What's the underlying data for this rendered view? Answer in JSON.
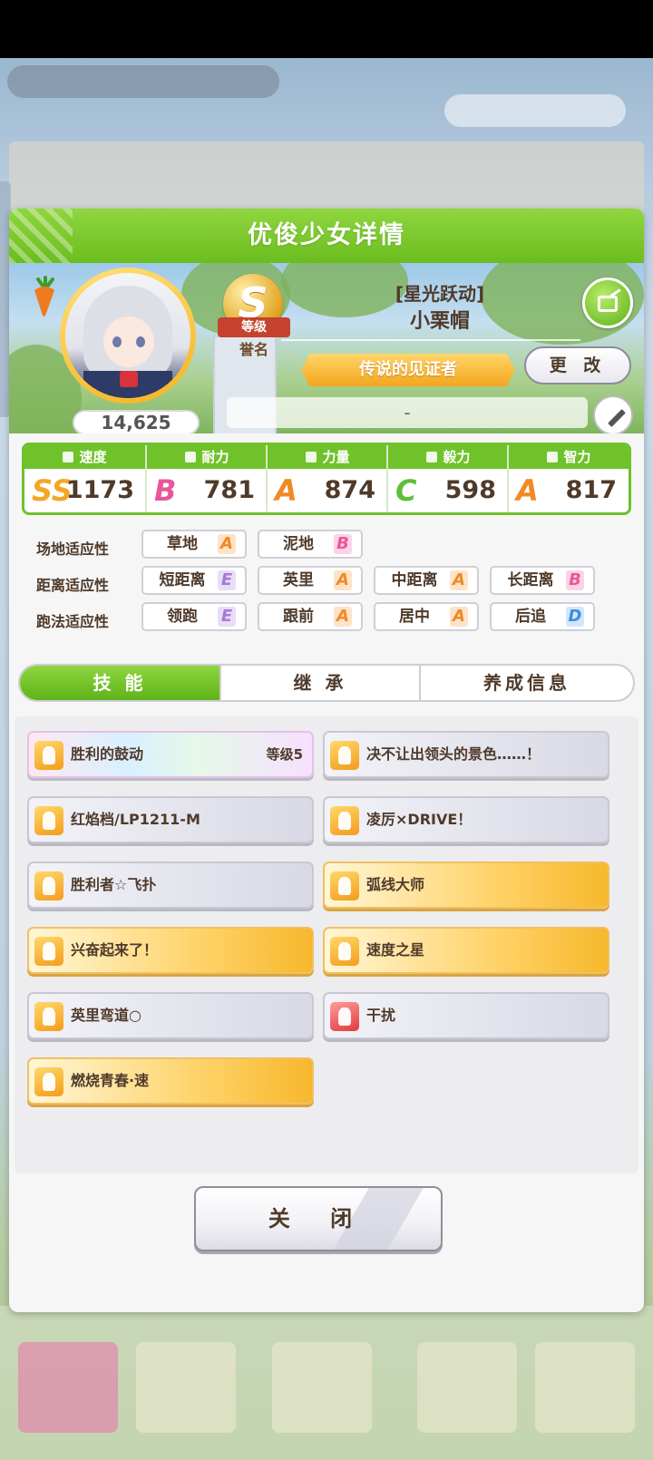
{
  "dialog": {
    "title": "优俊少女详情"
  },
  "profile": {
    "fans": "14,625",
    "rank_letter": "S",
    "rank_label": "等级",
    "rank_sub": "誉名",
    "epithet": "[星光跃动]",
    "name": "小栗帽",
    "title": "传说的见证者",
    "change_label": "更 改",
    "comment": "-"
  },
  "stats": [
    {
      "label": "速度",
      "grade": "SS",
      "grade_color": "#f5a623",
      "value": "1173"
    },
    {
      "label": "耐力",
      "grade": "B",
      "grade_color": "#e8569b",
      "value": "781"
    },
    {
      "label": "力量",
      "grade": "A",
      "grade_color": "#f08a24",
      "value": "874"
    },
    {
      "label": "毅力",
      "grade": "C",
      "grade_color": "#5cbf3a",
      "value": "598"
    },
    {
      "label": "智力",
      "grade": "A",
      "grade_color": "#f08a24",
      "value": "817"
    }
  ],
  "aptitude": {
    "rows": [
      {
        "label": "场地适应性",
        "items": [
          {
            "name": "草地",
            "grade": "A",
            "color": "#f08a24"
          },
          {
            "name": "泥地",
            "grade": "B",
            "color": "#e8569b"
          }
        ]
      },
      {
        "label": "距离适应性",
        "items": [
          {
            "name": "短距离",
            "grade": "E",
            "color": "#a57bd6"
          },
          {
            "name": "英里",
            "grade": "A",
            "color": "#f08a24"
          },
          {
            "name": "中距离",
            "grade": "A",
            "color": "#f08a24"
          },
          {
            "name": "长距离",
            "grade": "B",
            "color": "#e8569b"
          }
        ]
      },
      {
        "label": "跑法适应性",
        "items": [
          {
            "name": "领跑",
            "grade": "E",
            "color": "#a57bd6"
          },
          {
            "name": "跟前",
            "grade": "A",
            "color": "#f08a24"
          },
          {
            "name": "居中",
            "grade": "A",
            "color": "#f08a24"
          },
          {
            "name": "后追",
            "grade": "D",
            "color": "#3a8fe0"
          }
        ]
      }
    ]
  },
  "tabs": [
    "技 能",
    "继 承",
    "养成信息"
  ],
  "skills": [
    {
      "name": "胜利的鼓动",
      "level": "等级5",
      "style": "rainbow"
    },
    {
      "name": "决不让出领头的景色……！",
      "level": "",
      "style": "silver"
    },
    {
      "name": "红焰档/LP1211-M",
      "level": "",
      "style": "silver"
    },
    {
      "name": "凌厉×DRIVE！",
      "level": "",
      "style": "silver"
    },
    {
      "name": "胜利者☆飞扑",
      "level": "",
      "style": "silver"
    },
    {
      "name": "弧线大师",
      "level": "",
      "style": "gold"
    },
    {
      "name": "兴奋起来了！",
      "level": "",
      "style": "gold"
    },
    {
      "name": "速度之星",
      "level": "",
      "style": "gold"
    },
    {
      "name": "英里弯道○",
      "level": "",
      "style": "silver"
    },
    {
      "name": "干扰",
      "level": "",
      "style": "silver-red"
    },
    {
      "name": "燃烧青春·速",
      "level": "",
      "style": "gold"
    }
  ],
  "close_label": "关 闭"
}
